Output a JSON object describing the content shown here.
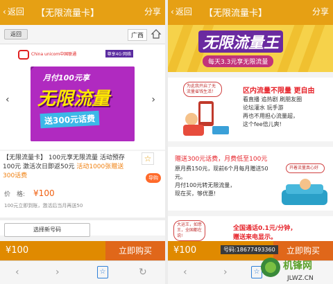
{
  "left": {
    "topbar": {
      "back": "返回",
      "title": "【无限流量卡】",
      "share": "分享"
    },
    "subbar": {
      "back_button": "返回",
      "region": "广西"
    },
    "banner": {
      "brand": "China unicom中国联通",
      "tag": "尊享4G·网络",
      "line1": "月付100元享",
      "line2": "无限流量",
      "line3": "送300元话费"
    },
    "product": {
      "desc_main": "【无限流量卡】 100元享无限流量 活动预存100元 激活次日即返50元 ",
      "desc_orange": "活动1000张赠送300话费",
      "guide": "导购",
      "price_label": "价　格:",
      "price_value": "¥100",
      "note": "100元立即到账，激活后当月再送50"
    },
    "choose_number": "选择新号码",
    "buybar": {
      "price": "¥100",
      "buy": "立即购买"
    }
  },
  "right": {
    "topbar": {
      "back": "返回",
      "title": "【无限流量卡】",
      "share": "分享"
    },
    "hero": {
      "title": "无限流量王",
      "subtitle": "每天3.3元享无限流量"
    },
    "card1": {
      "bubble": "为此我开启了无流量省钱生活！",
      "head": "区内流量不限量  更自由",
      "body": "看直播  追热剧  刷朋友圈\n论坛灌水  玩手游\n再也不用担心流量超，\n这个fee倍儿爽!"
    },
    "card2": {
      "head": "赠送300元话费，月费低至100元",
      "body": "原月费150元，现前6个月每月赠送50元。\n月付100元转无限流量，\n现在买，够优惠!",
      "bubble": "开着流量真心好"
    },
    "card3": {
      "bubble": "大运王，如意王，全国都在说!",
      "head": "全国通话0.1元/分钟，\n赠送来电显示。"
    },
    "phone_number": "号码:18677493360",
    "buybar": {
      "price": "¥100",
      "buy": "立即购买"
    },
    "watermark": "机锋网 JLWZ.CN"
  },
  "colors": {
    "accent": "#e6a014",
    "buy": "#e0671a",
    "purple": "#8c1f9d",
    "red": "#e6232a"
  }
}
